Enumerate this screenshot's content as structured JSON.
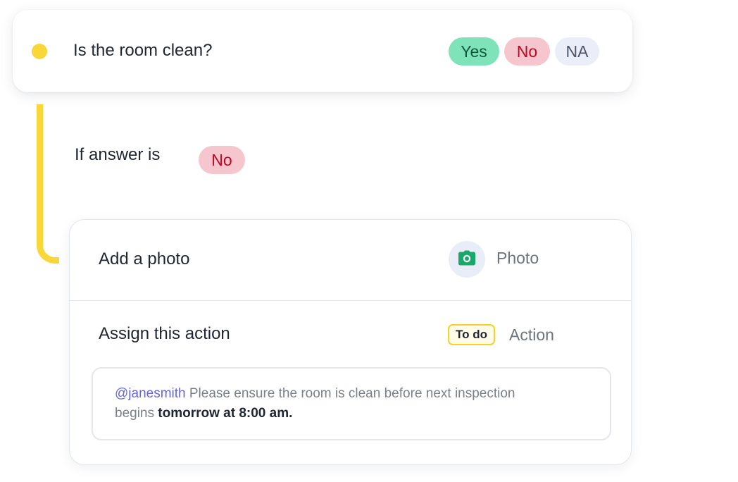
{
  "question": {
    "text": "Is the room clean?",
    "options": {
      "yes": "Yes",
      "no": "No",
      "na": "NA"
    },
    "status_color": "#fad739"
  },
  "logic": {
    "condition_label": "If answer is",
    "condition_value": "No"
  },
  "actions": {
    "photo_row_label": "Add a photo",
    "photo_button_label": "Photo",
    "photo_icon": "camera-icon",
    "action_row_label": "Assign this action",
    "status_badge": "To do",
    "action_button_label": "Action",
    "message": {
      "mention": "@janesmith",
      "body_line1": " Please ensure the room is clean before next inspection",
      "body_line2": "begins ",
      "emphasis": "tomorrow at 8:00 am."
    }
  },
  "colors": {
    "yes_bg": "#7fe3ba",
    "no_bg": "#f6c6cf",
    "na_bg": "#ebeef8",
    "accent_yellow": "#fad739",
    "mention": "#6466dd",
    "camera": "#1aa86a"
  }
}
